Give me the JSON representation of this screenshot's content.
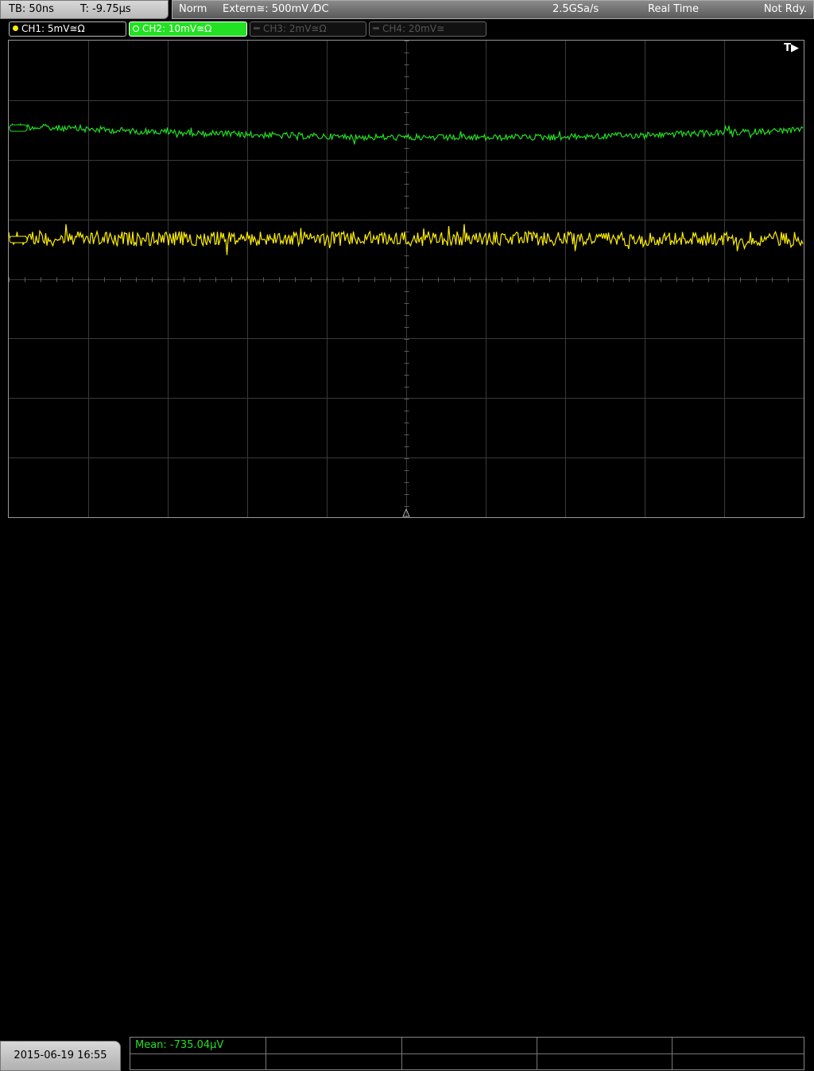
{
  "timebase": {
    "tb": "TB: 50ns",
    "trigger_time": "T: -9.75µs"
  },
  "status": {
    "mode": "Norm",
    "trigger_source": "Extern≅: 500mV ⁄DC",
    "sample_rate": "2.5GSa/s",
    "acq_mode": "Real Time",
    "state": "Not Rdy."
  },
  "channels": [
    {
      "label": "CH1: 5mV≅Ω",
      "color": "#ffee00",
      "active": true
    },
    {
      "label": "CH2: 10mV≅Ω",
      "color": "#22e022",
      "active": true
    },
    {
      "label": "CH3: 2mV≅Ω",
      "color": "#444444",
      "active": false
    },
    {
      "label": "CH4: 20mV≅",
      "color": "#444444",
      "active": false
    }
  ],
  "trigger_marker": "T▶",
  "measurement": {
    "mean": "Mean: -735.04µV"
  },
  "datetime": "2015-06-19 16:55",
  "icons": {
    "trigger": "trigger-arrow-icon",
    "channel_dot": "channel-dot-icon"
  }
}
